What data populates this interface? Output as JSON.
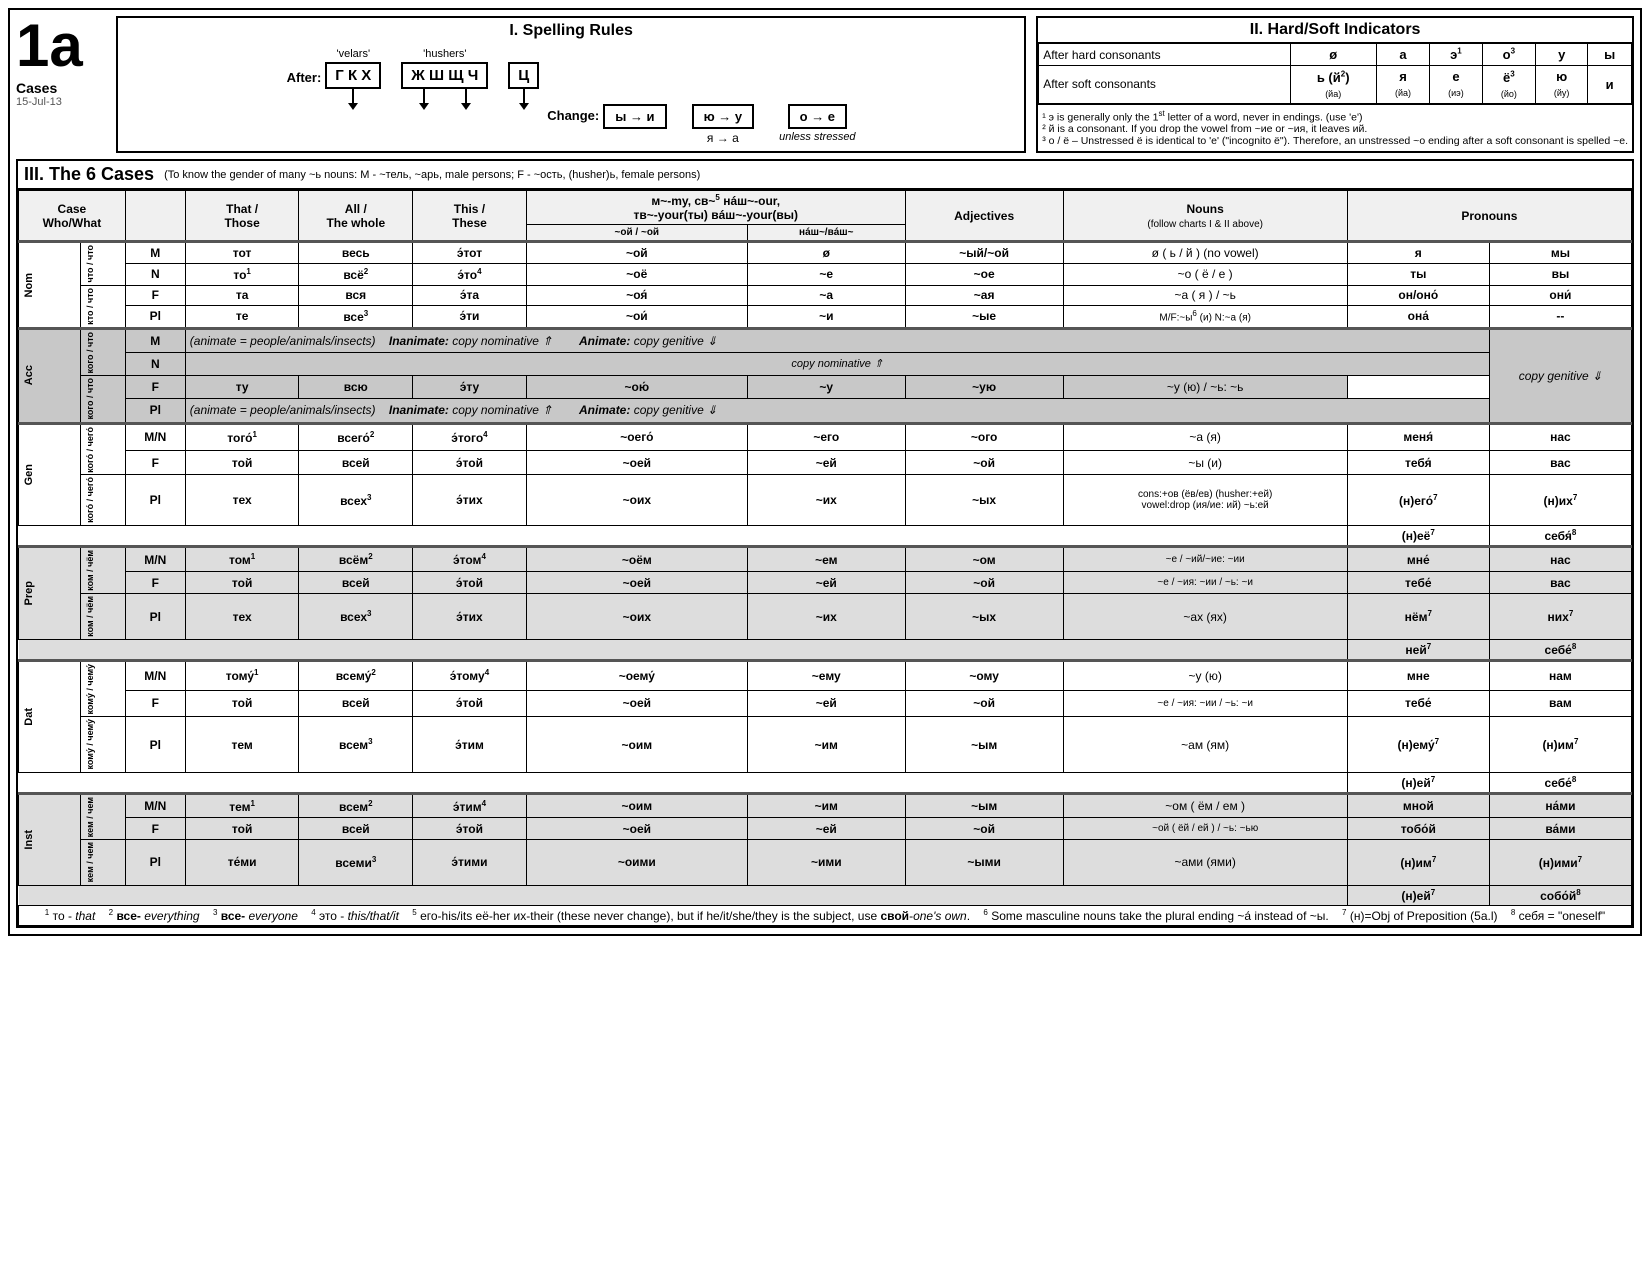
{
  "page": {
    "label_1a": "1a",
    "cases_label": "Cases",
    "date": "15-Jul-13",
    "section1_title": "I. Spelling Rules",
    "section2_title": "II. Hard/Soft Indicators",
    "section3_title": "III. The 6 Cases",
    "section3_subtitle": "(To know the gender of many ~ь nouns: M - ~тель, ~арь, male persons; F - ~ость, (husher)ь, female persons)",
    "after_label": "After:",
    "change_label": "Change:",
    "velars_label": "'velars'",
    "hushers_label": "'hushers'",
    "velar_letters": "Г К Х",
    "husher_letters": "Ж Ш Щ Ч",
    "ts_letter": "Ц",
    "change1": "ы → и",
    "change2a": "ю → у",
    "change2b": "я → а",
    "change3": "о → е",
    "change3b": "unless stressed",
    "hs": {
      "hard_label": "After hard consonants",
      "soft_label": "After soft consonants",
      "headers": [
        "ø",
        "а",
        "э¹",
        "о³",
        "у",
        "ы"
      ],
      "soft_row": [
        "ь (й²)",
        "я",
        "е",
        "ё³",
        "ю",
        "и"
      ],
      "soft_sub": [
        "(йа)",
        "(иэ)",
        "(йо)",
        "(йу)",
        ""
      ],
      "note1": "¹ э is generally only the 1st letter of a word, never in endings. (use 'е')",
      "note2": "² й is a consonant. If you drop the vowel from ~ие or ~ия, it leaves ий.",
      "note3": "³ о / ё – Unstressed ё is identical to 'е' (\"incognito ё\"). Therefore, an unstressed ~о ending after a soft consonant is spelled ~е."
    },
    "cases_table": {
      "col_headers": [
        "Case\nWho/What",
        "That /\nThose",
        "All /\nThe whole",
        "This /\nThese",
        "м~-my, св~⁵ нáш~-our,\nтв~-your(ты) вáш~-your(вы)",
        "Adjectives\n(follow charts I & II above)",
        "Nouns",
        "Pronouns"
      ],
      "col_sub": [
        "",
        "",
        "",
        "",
        "",
        "",
        "(follow charts I & II above)",
        ""
      ],
      "rows": []
    }
  }
}
